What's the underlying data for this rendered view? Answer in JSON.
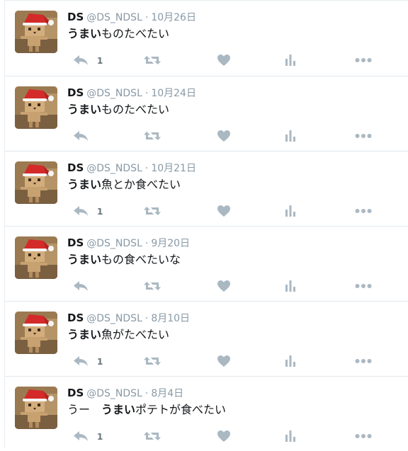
{
  "tweets": [
    {
      "name": "DS",
      "handle": "@DS_NDSL",
      "separator": "·",
      "date": "10月26日",
      "text_bold": "うまい",
      "text_rest": "ものたべたい",
      "reply_count": "1"
    },
    {
      "name": "DS",
      "handle": "@DS_NDSL",
      "separator": "·",
      "date": "10月24日",
      "text_bold": "うまい",
      "text_rest": "ものたべたい",
      "reply_count": ""
    },
    {
      "name": "DS",
      "handle": "@DS_NDSL",
      "separator": "·",
      "date": "10月21日",
      "text_bold": "うまい",
      "text_rest": "魚とか食べたい",
      "reply_count": "1"
    },
    {
      "name": "DS",
      "handle": "@DS_NDSL",
      "separator": "·",
      "date": "9月20日",
      "text_bold": "うまい",
      "text_rest": "もの食べたいな",
      "reply_count": ""
    },
    {
      "name": "DS",
      "handle": "@DS_NDSL",
      "separator": "·",
      "date": "8月10日",
      "text_bold": "うまい",
      "text_rest": "魚がたべたい",
      "reply_count": "1"
    },
    {
      "name": "DS",
      "handle": "@DS_NDSL",
      "separator": "·",
      "date": "8月4日",
      "text_prefix": "うー　",
      "text_bold": "うまい",
      "text_rest": "ポテトが食べたい",
      "reply_count": "1"
    }
  ],
  "colors": {
    "text": "#14171a",
    "muted": "#8899a6",
    "icon": "#aab8c2",
    "divider": "#e1e8ed"
  },
  "icons": {
    "avatar": "danbo-santa-hat-avatar",
    "reply": "reply-icon",
    "retweet": "retweet-icon",
    "like": "heart-icon",
    "analytics": "analytics-icon",
    "more": "more-dots-icon"
  }
}
